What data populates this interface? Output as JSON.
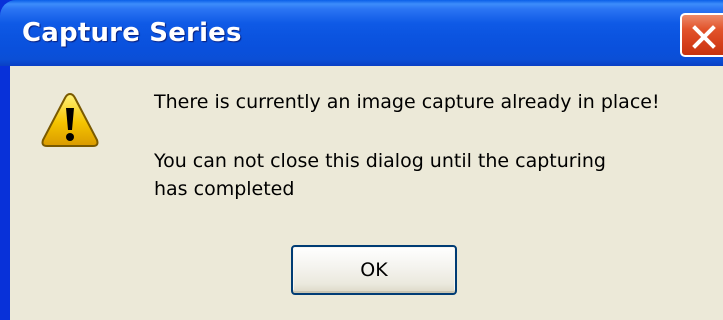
{
  "window": {
    "title": "Capture Series",
    "close_icon": "close-x-icon"
  },
  "dialog": {
    "icon": "warning-icon",
    "message_line_1": "There is currently an image capture already in place!",
    "message_line_2": "You can not close this dialog until the capturing",
    "message_line_3": "has completed",
    "ok_label": "OK"
  },
  "colors": {
    "titlebar": "#0b54e0",
    "close_button": "#d6401b",
    "dialog_background": "#ece9d8",
    "warning_yellow": "#f5c400",
    "button_border": "#003c74"
  }
}
